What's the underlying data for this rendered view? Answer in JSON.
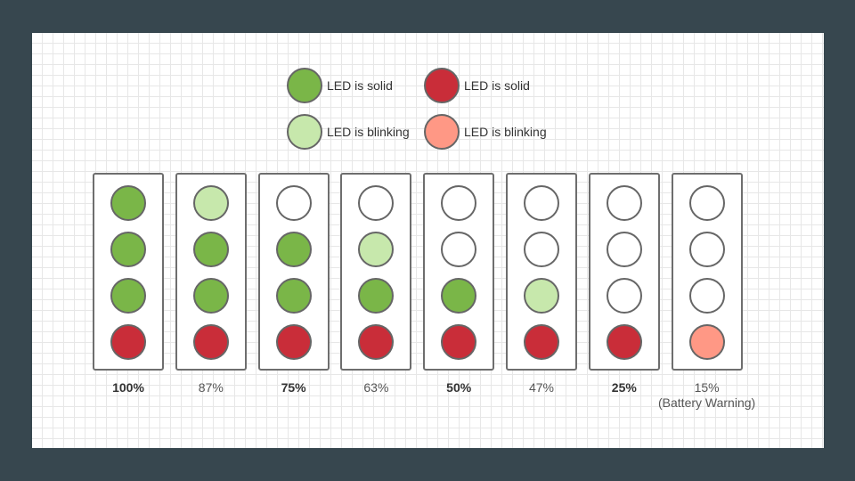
{
  "colors": {
    "solid_green": "#7ab648",
    "blinking_green": "#c7e8ac",
    "solid_red": "#c92d39",
    "blinking_red": "#ff9885",
    "off": "#ffffff"
  },
  "legend": [
    {
      "state": "solid_green",
      "label": "LED is solid"
    },
    {
      "state": "solid_red",
      "label": "LED is solid"
    },
    {
      "state": "blinking_green",
      "label": "LED is blinking"
    },
    {
      "state": "blinking_red",
      "label": "LED is blinking"
    }
  ],
  "columns": [
    {
      "label": "100%",
      "note": "",
      "bold": true,
      "leds": [
        "solid_green",
        "solid_green",
        "solid_green",
        "solid_red"
      ]
    },
    {
      "label": "87%",
      "note": "",
      "bold": false,
      "leds": [
        "blinking_green",
        "solid_green",
        "solid_green",
        "solid_red"
      ]
    },
    {
      "label": "75%",
      "note": "",
      "bold": true,
      "leds": [
        "off",
        "solid_green",
        "solid_green",
        "solid_red"
      ]
    },
    {
      "label": "63%",
      "note": "",
      "bold": false,
      "leds": [
        "off",
        "blinking_green",
        "solid_green",
        "solid_red"
      ]
    },
    {
      "label": "50%",
      "note": "",
      "bold": true,
      "leds": [
        "off",
        "off",
        "solid_green",
        "solid_red"
      ]
    },
    {
      "label": "47%",
      "note": "",
      "bold": false,
      "leds": [
        "off",
        "off",
        "blinking_green",
        "solid_red"
      ]
    },
    {
      "label": "25%",
      "note": "",
      "bold": true,
      "leds": [
        "off",
        "off",
        "off",
        "solid_red"
      ]
    },
    {
      "label": "15%",
      "note": "(Battery Warning)",
      "bold": false,
      "leds": [
        "off",
        "off",
        "off",
        "blinking_red"
      ]
    }
  ]
}
